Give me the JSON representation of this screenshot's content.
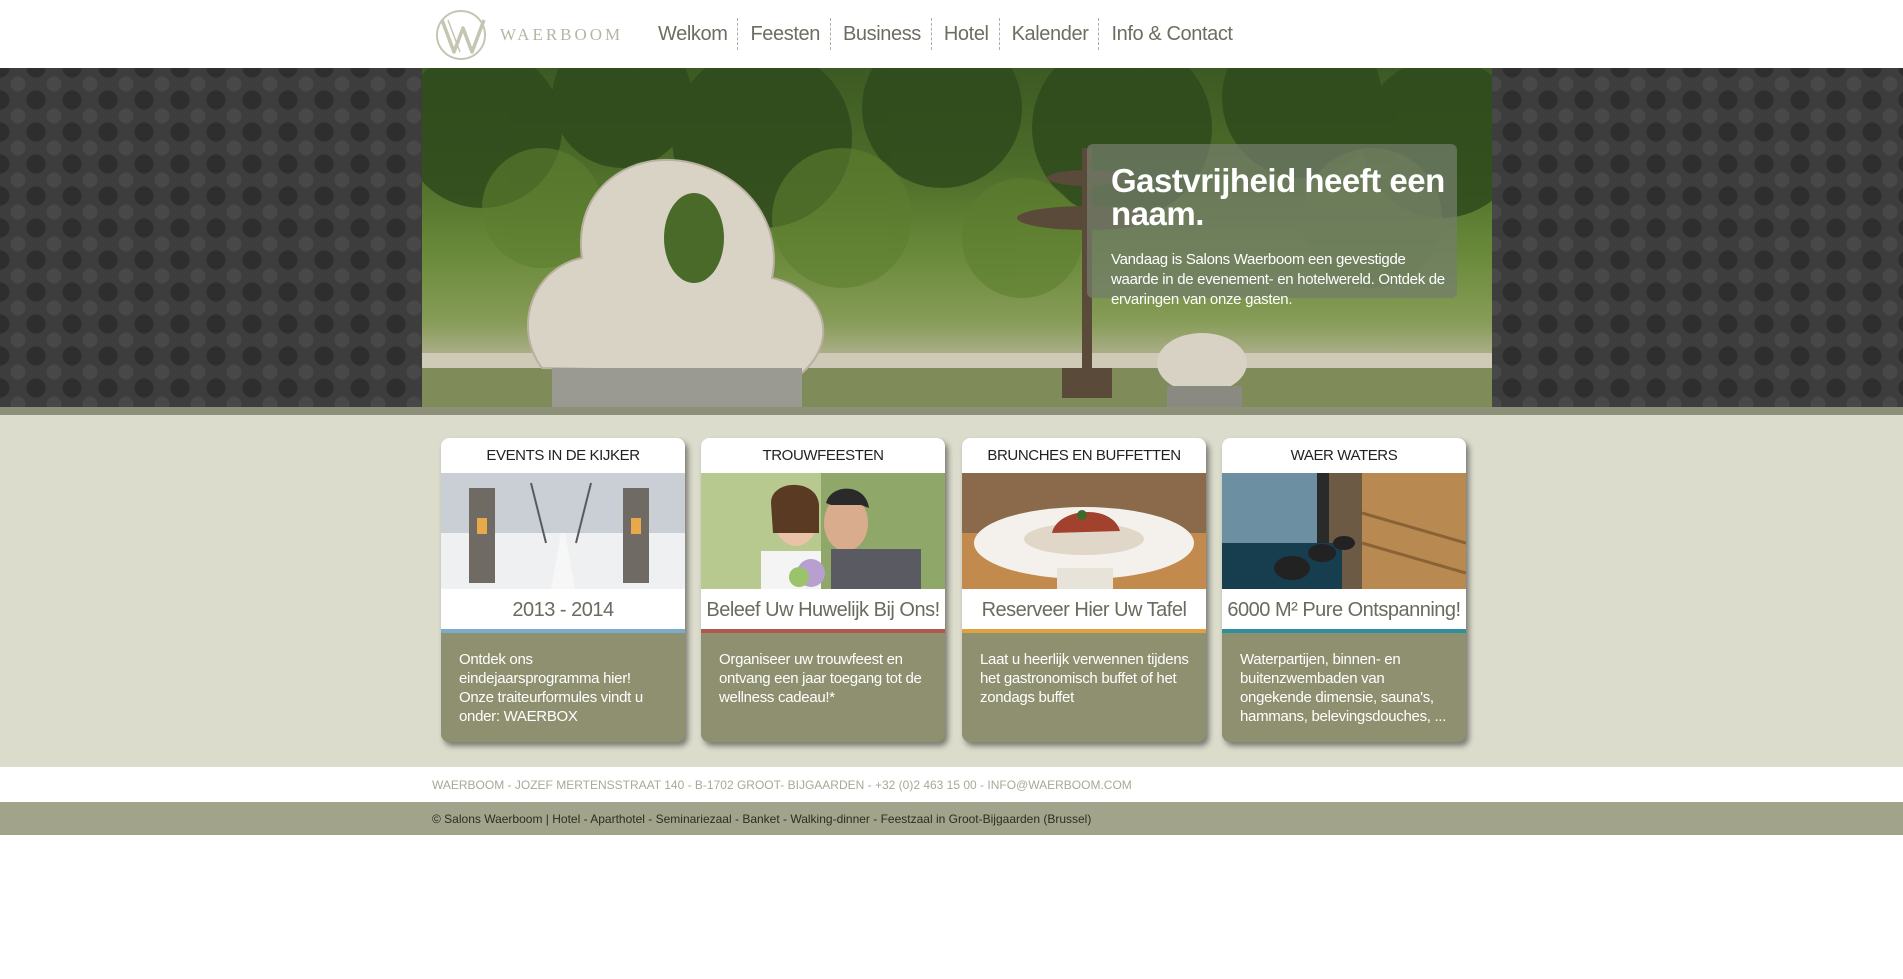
{
  "brand": {
    "logo_text": "WAERBOOM"
  },
  "nav": {
    "items": [
      "Welkom",
      "Feesten",
      "Business",
      "Hotel",
      "Kalender",
      "Info & Contact"
    ]
  },
  "hero": {
    "title": "Gastvrijheid heeft een naam.",
    "text": "Vandaag is Salons Waerboom een gevestigde waarde in de evenement- en hotelwereld. Ontdek de ervaringen van onze gasten."
  },
  "cards": [
    {
      "heading": "EVENTS IN DE KIJKER",
      "subtitle": "2013 - 2014",
      "body": "Ontdek ons eindejaarsprogramma hier!\nOnze traiteurformules vindt u onder: WAERBOX",
      "accent": "#7aaccc"
    },
    {
      "heading": "TROUWFEESTEN",
      "subtitle": "Beleef Uw Huwelijk Bij Ons!",
      "body": "Organiseer uw trouwfeest en ontvang een jaar toegang tot de wellness cadeau!*",
      "accent": "#b0584e"
    },
    {
      "heading": "BRUNCHES EN BUFFETTEN",
      "subtitle": "Reserveer Hier Uw Tafel",
      "body": "Laat u heerlijk verwennen tijdens het gastronomisch buffet of het zondags buffet",
      "accent": "#e0a23d"
    },
    {
      "heading": "WAER WATERS",
      "subtitle": "6000 M² Pure Ontspanning!",
      "body": "Waterpartijen, binnen- en buitenzwembaden van ongekende dimensie, sauna's, hammans, belevingsdouches, ...",
      "accent": "#2f8f9e"
    }
  ],
  "footer": {
    "address": "WAERBOOM - JOZEF MERTENSSTRAAT 140 - B-1702 GROOT- BIJGAARDEN - +32 (0)2 463 15 00 - INFO@WAERBOOM.COM",
    "copyright": "© Salons Waerboom | Hotel - Aparthotel - Seminariezaal - Banket - Walking-dinner - Feestzaal in Groot-Bijgaarden (Brussel)"
  }
}
